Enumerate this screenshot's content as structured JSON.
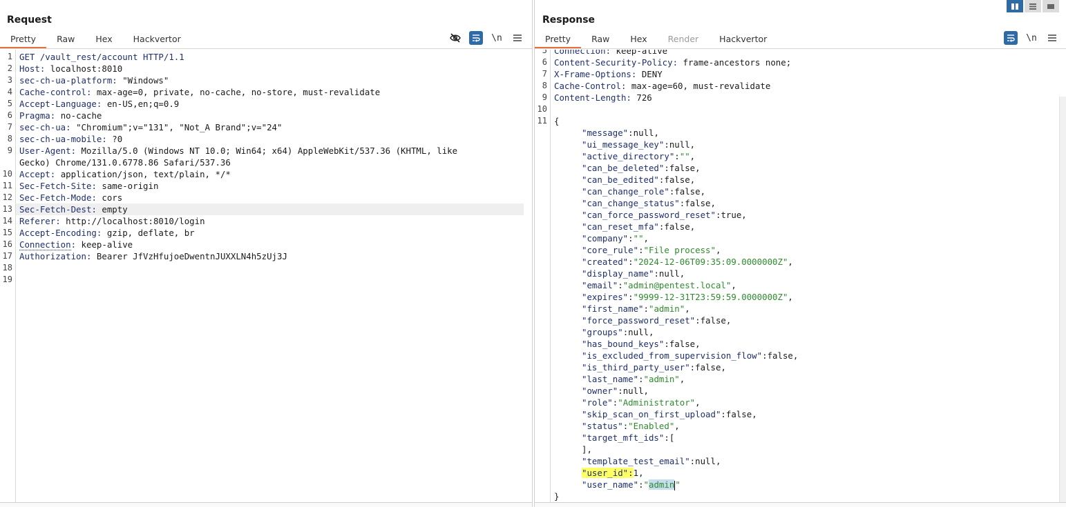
{
  "request": {
    "title": "Request",
    "tabs": [
      {
        "label": "Pretty",
        "active": true
      },
      {
        "label": "Raw"
      },
      {
        "label": "Hex"
      },
      {
        "label": "Hackvertor"
      }
    ],
    "toolbar": {
      "hide_icon": "eye-slash-icon",
      "wrap_icon": "text-wrap-icon",
      "newline_label": "\\n",
      "menu_icon": "hamburger-icon"
    },
    "lines": [
      {
        "n": "1",
        "key": "GET /vault_rest/account HTTP/1.1",
        "sep": "",
        "value": ""
      },
      {
        "n": "2",
        "key": "Host",
        "sep": ": ",
        "value": "localhost:8010"
      },
      {
        "n": "3",
        "key": "sec-ch-ua-platform",
        "sep": ": ",
        "value": "\"Windows\""
      },
      {
        "n": "4",
        "key": "Cache-control",
        "sep": ": ",
        "value": "max-age=0, private, no-cache, no-store, must-revalidate"
      },
      {
        "n": "5",
        "key": "Accept-Language",
        "sep": ": ",
        "value": "en-US,en;q=0.9"
      },
      {
        "n": "6",
        "key": "Pragma",
        "sep": ": ",
        "value": "no-cache"
      },
      {
        "n": "7",
        "key": "sec-ch-ua",
        "sep": ": ",
        "value": "\"Chromium\";v=\"131\", \"Not_A Brand\";v=\"24\""
      },
      {
        "n": "8",
        "key": "sec-ch-ua-mobile",
        "sep": ": ",
        "value": "?0"
      },
      {
        "n": "9",
        "key": "User-Agent",
        "sep": ": ",
        "value": "Mozilla/5.0 (Windows NT 10.0; Win64; x64) AppleWebKit/537.36 (KHTML, like"
      },
      {
        "n": "",
        "key": "",
        "sep": "",
        "value": "Gecko) Chrome/131.0.6778.86 Safari/537.36"
      },
      {
        "n": "10",
        "key": "Accept",
        "sep": ": ",
        "value": "application/json, text/plain, */*"
      },
      {
        "n": "11",
        "key": "Sec-Fetch-Site",
        "sep": ": ",
        "value": "same-origin"
      },
      {
        "n": "12",
        "key": "Sec-Fetch-Mode",
        "sep": ": ",
        "value": "cors"
      },
      {
        "n": "13",
        "key": "Sec-Fetch-Dest",
        "sep": ": ",
        "value": "empty",
        "highlight": true
      },
      {
        "n": "14",
        "key": "Referer",
        "sep": ": ",
        "value": "http://localhost:8010/login"
      },
      {
        "n": "15",
        "key": "Accept-Encoding",
        "sep": ": ",
        "value": "gzip, deflate, br"
      },
      {
        "n": "16",
        "key": "Connection",
        "sep": ": ",
        "value": "keep-alive",
        "dotted": true
      },
      {
        "n": "17",
        "key": "Authorization",
        "sep": ": ",
        "value": "Bearer JfVzHfujoeDwentnJUXXLN4h5zUj3J"
      },
      {
        "n": "18",
        "key": "",
        "sep": "",
        "value": ""
      },
      {
        "n": "19",
        "key": "",
        "sep": "",
        "value": ""
      }
    ]
  },
  "response": {
    "title": "Response",
    "tabs": [
      {
        "label": "Pretty",
        "active": true
      },
      {
        "label": "Raw"
      },
      {
        "label": "Hex"
      },
      {
        "label": "Render",
        "disabled": true
      },
      {
        "label": "Hackvertor"
      }
    ],
    "toolbar": {
      "wrap_icon": "text-wrap-icon",
      "newline_label": "\\n",
      "menu_icon": "hamburger-icon"
    },
    "header_lines": [
      {
        "n": "5",
        "key": "Connection",
        "sep": ": ",
        "value": "keep-alive"
      },
      {
        "n": "6",
        "key": "Content-Security-Policy",
        "sep": ": ",
        "value": "frame-ancestors none;"
      },
      {
        "n": "7",
        "key": "X-Frame-Options",
        "sep": ": ",
        "value": "DENY"
      },
      {
        "n": "8",
        "key": "Cache-Control",
        "sep": ": ",
        "value": "max-age=60, must-revalidate"
      },
      {
        "n": "9",
        "key": "Content-Length",
        "sep": ": ",
        "value": "726"
      },
      {
        "n": "10",
        "key": "",
        "sep": "",
        "value": ""
      }
    ],
    "json_open": {
      "n": "11",
      "text": "{"
    },
    "json_fields": [
      {
        "key": "\"message\"",
        "value": "null",
        "type": "lit"
      },
      {
        "key": "\"ui_message_key\"",
        "value": "null",
        "type": "lit"
      },
      {
        "key": "\"active_directory\"",
        "value": "\"\"",
        "type": "str"
      },
      {
        "key": "\"can_be_deleted\"",
        "value": "false",
        "type": "lit"
      },
      {
        "key": "\"can_be_edited\"",
        "value": "false",
        "type": "lit"
      },
      {
        "key": "\"can_change_role\"",
        "value": "false",
        "type": "lit"
      },
      {
        "key": "\"can_change_status\"",
        "value": "false",
        "type": "lit"
      },
      {
        "key": "\"can_force_password_reset\"",
        "value": "true",
        "type": "lit"
      },
      {
        "key": "\"can_reset_mfa\"",
        "value": "false",
        "type": "lit"
      },
      {
        "key": "\"company\"",
        "value": "\"\"",
        "type": "str"
      },
      {
        "key": "\"core_rule\"",
        "value": "\"File process\"",
        "type": "str"
      },
      {
        "key": "\"created\"",
        "value": "\"2024-12-06T09:35:09.0000000Z\"",
        "type": "str"
      },
      {
        "key": "\"display_name\"",
        "value": "null",
        "type": "lit"
      },
      {
        "key": "\"email\"",
        "value": "\"admin@pentest.local\"",
        "type": "str"
      },
      {
        "key": "\"expires\"",
        "value": "\"9999-12-31T23:59:59.0000000Z\"",
        "type": "str"
      },
      {
        "key": "\"first_name\"",
        "value": "\"admin\"",
        "type": "str"
      },
      {
        "key": "\"force_password_reset\"",
        "value": "false",
        "type": "lit"
      },
      {
        "key": "\"groups\"",
        "value": "null",
        "type": "lit"
      },
      {
        "key": "\"has_bound_keys\"",
        "value": "false",
        "type": "lit"
      },
      {
        "key": "\"is_excluded_from_supervision_flow\"",
        "value": "false",
        "type": "lit"
      },
      {
        "key": "\"is_third_party_user\"",
        "value": "false",
        "type": "lit"
      },
      {
        "key": "\"last_name\"",
        "value": "\"admin\"",
        "type": "str"
      },
      {
        "key": "\"owner\"",
        "value": "null",
        "type": "lit"
      },
      {
        "key": "\"role\"",
        "value": "\"Administrator\"",
        "type": "str"
      },
      {
        "key": "\"skip_scan_on_first_upload\"",
        "value": "false",
        "type": "lit"
      },
      {
        "key": "\"status\"",
        "value": "\"Enabled\"",
        "type": "str"
      },
      {
        "key": "\"target_mft_ids\"",
        "value": "[",
        "type": "lit",
        "no_comma": true
      },
      {
        "key": "",
        "value": "]",
        "type": "close"
      },
      {
        "key": "\"template_test_email\"",
        "value": "null",
        "type": "lit"
      },
      {
        "key": "\"user_id\"",
        "value": "1",
        "type": "lit",
        "highlight": "yellow"
      },
      {
        "key": "\"user_name\"",
        "value": "admin",
        "type": "selected",
        "no_comma": true
      }
    ],
    "json_close": "}"
  },
  "layout_switch": [
    {
      "icon": "split-columns-icon",
      "active": true
    },
    {
      "icon": "split-rows-icon"
    },
    {
      "icon": "single-pane-icon"
    }
  ]
}
